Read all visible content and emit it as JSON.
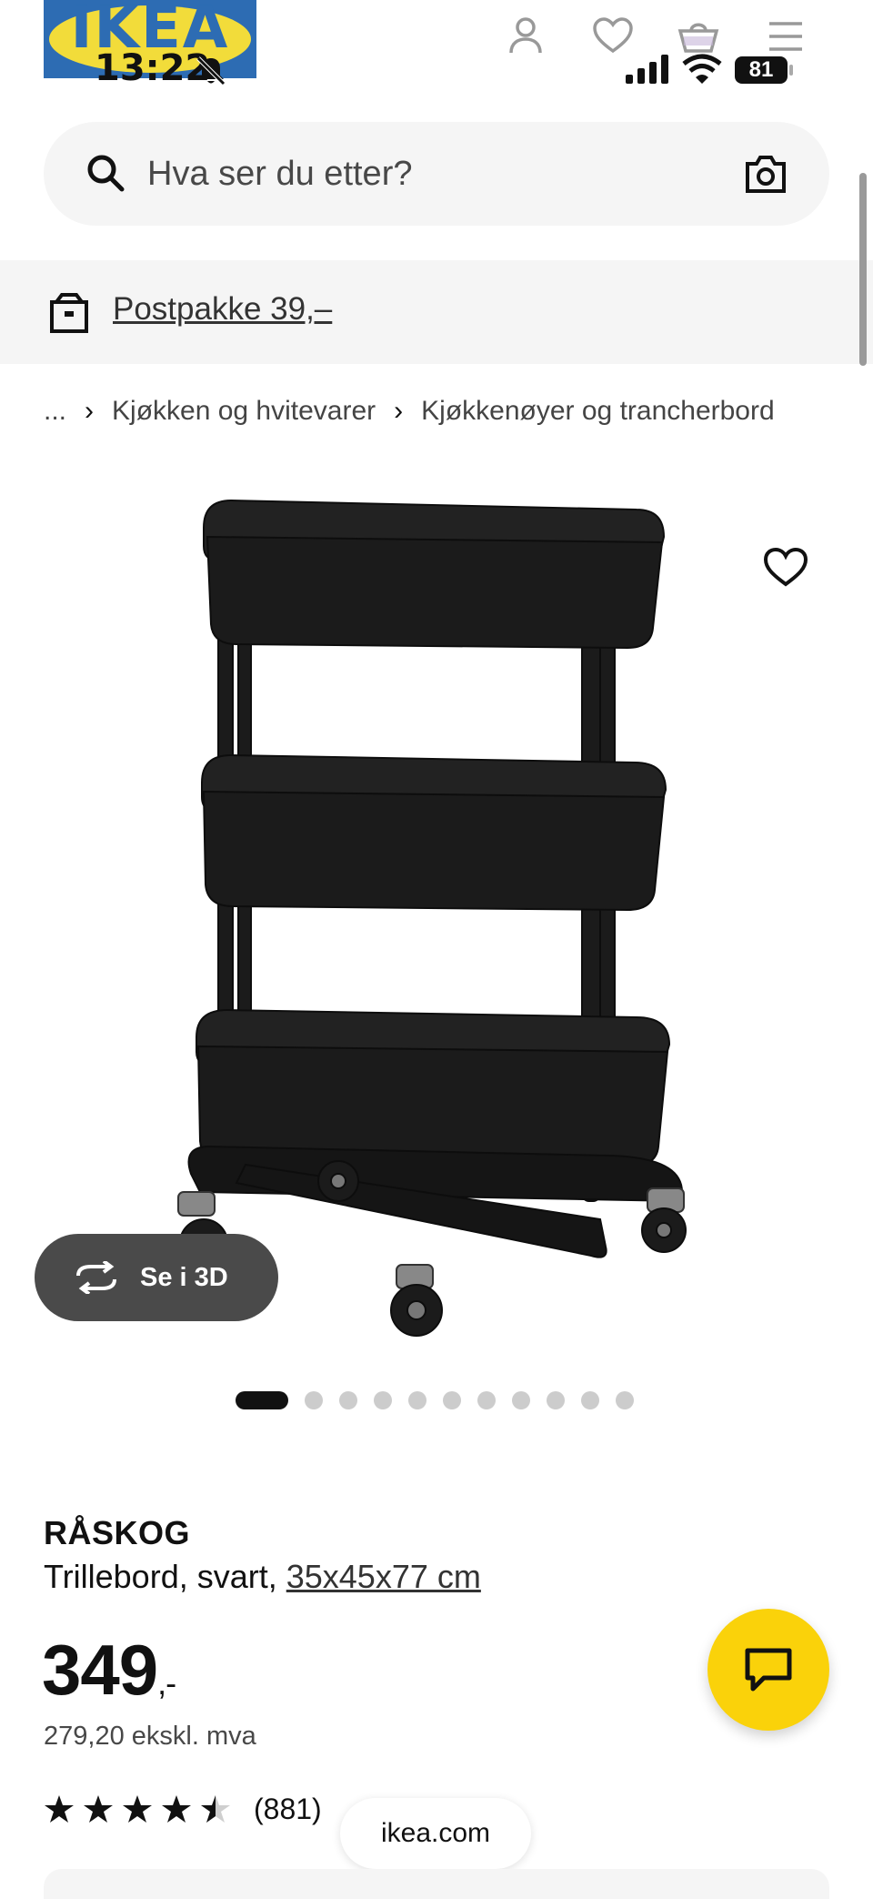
{
  "header": {
    "logo_text": "IKEA",
    "status": {
      "time": "13:22",
      "battery": "81"
    },
    "icons": [
      "profile-icon",
      "heart-icon",
      "basket-icon",
      "menu-icon"
    ]
  },
  "search": {
    "placeholder": "Hva ser du etter?"
  },
  "promo": {
    "text": "Postpakke 39,–"
  },
  "breadcrumb": {
    "ellipsis": "...",
    "items": [
      "Kjøkken og hvitevarer",
      "Kjøkkenøyer og trancherbord"
    ]
  },
  "gallery": {
    "view_3d_label": "Se i 3D",
    "image_count": 12,
    "active_index": 0
  },
  "product": {
    "name": "RÅSKOG",
    "description": "Trillebord, svart, ",
    "dimensions": "35x45x77 cm",
    "price": "349",
    "price_suffix": ",-",
    "price_ex_vat": "279,20 ekskl. mva",
    "rating": 4.5,
    "review_count": "(881)"
  },
  "browser": {
    "url": "ikea.com"
  },
  "colors": {
    "brand_blue": "#0058a3",
    "brand_yellow": "#fbd914",
    "chat_yellow": "#fad20a"
  }
}
